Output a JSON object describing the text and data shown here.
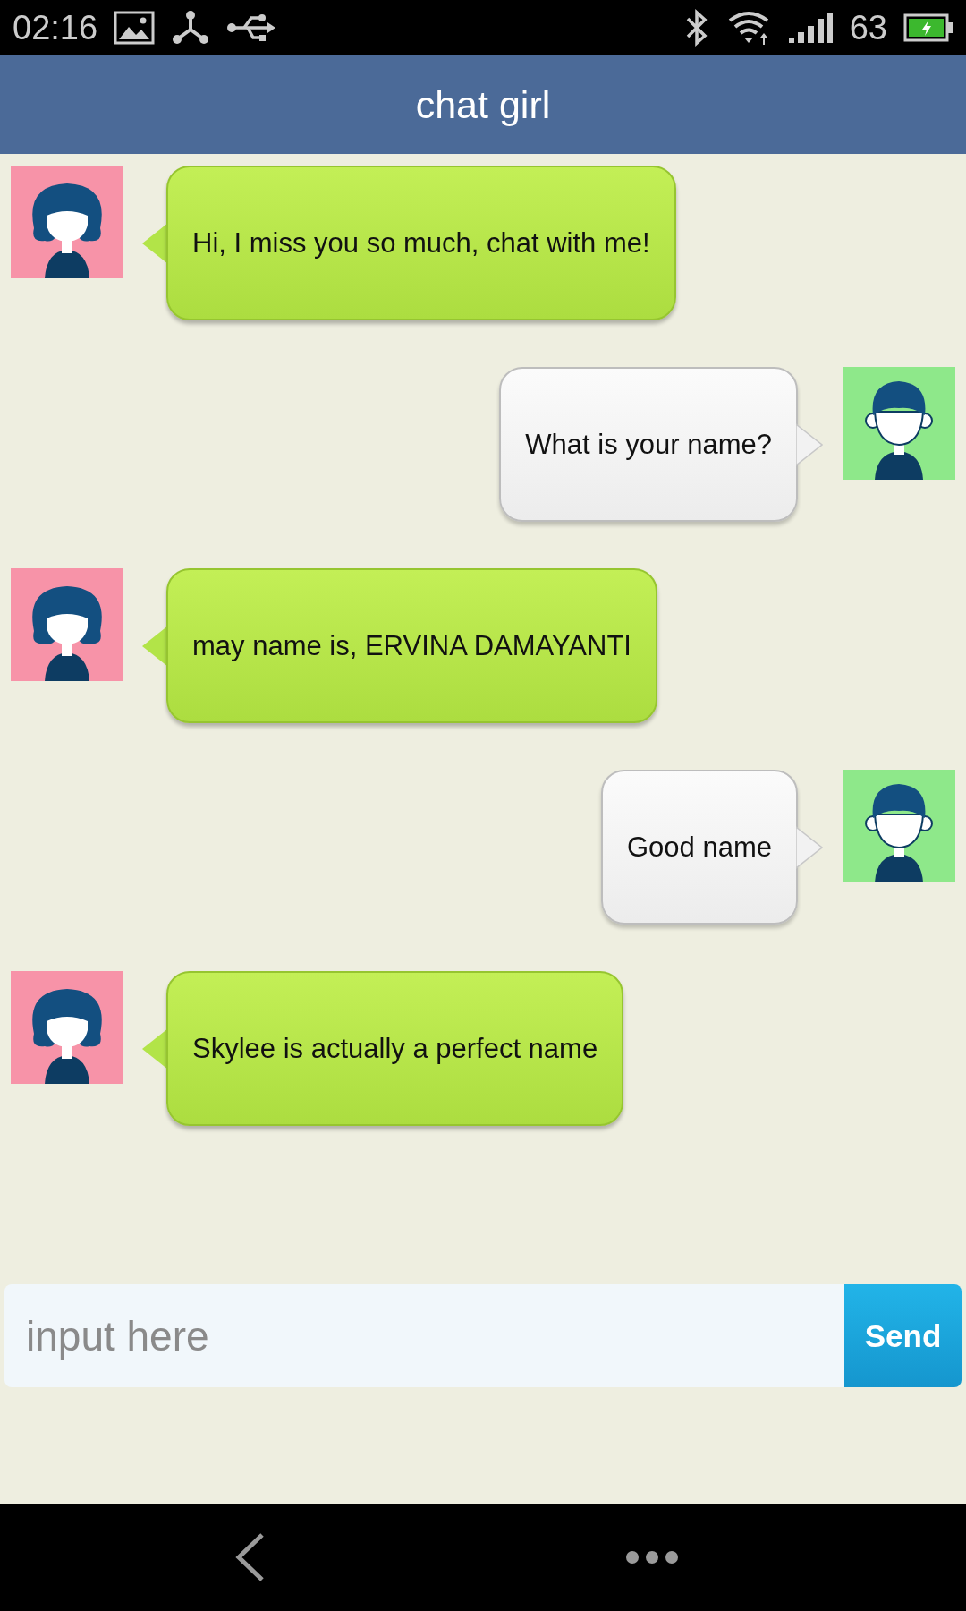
{
  "status_bar": {
    "time": "02:16",
    "battery": "63"
  },
  "header": {
    "title": "chat girl"
  },
  "messages": [
    {
      "kind": "received",
      "text": "Hi, I miss you so much, chat with me!"
    },
    {
      "kind": "sent",
      "text": "What is your name?"
    },
    {
      "kind": "received",
      "text": "may name is, ERVINA DAMAYANTI"
    },
    {
      "kind": "sent",
      "text": "Good name"
    },
    {
      "kind": "received",
      "text": "Skylee is actually a perfect name"
    }
  ],
  "composer": {
    "placeholder": "input here",
    "send": "Send"
  }
}
